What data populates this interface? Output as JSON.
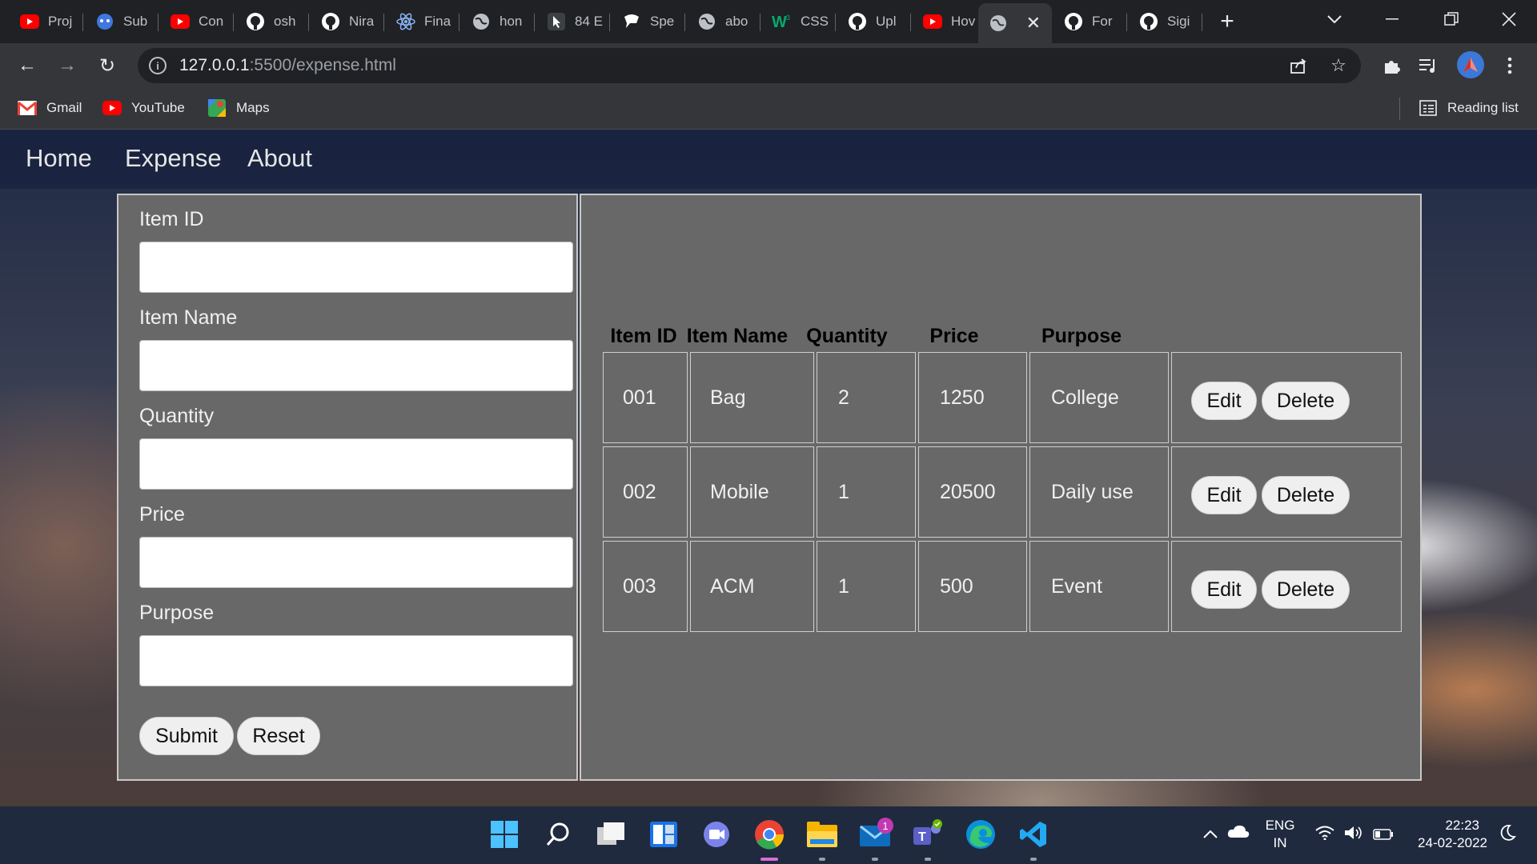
{
  "browser": {
    "tabs": [
      {
        "label": "Proj",
        "icon": "youtube-icon"
      },
      {
        "label": "Sub",
        "icon": "bot-icon"
      },
      {
        "label": "Con",
        "icon": "youtube-icon"
      },
      {
        "label": "osh",
        "icon": "github-icon"
      },
      {
        "label": "Nira",
        "icon": "github-icon"
      },
      {
        "label": "Fina",
        "icon": "react-icon"
      },
      {
        "label": "hon",
        "icon": "globe-icon"
      },
      {
        "label": "84 E",
        "icon": "cursor-icon"
      },
      {
        "label": "Spe",
        "icon": "speech-icon"
      },
      {
        "label": "abo",
        "icon": "globe-icon"
      },
      {
        "label": "CSS",
        "icon": "w3-icon"
      },
      {
        "label": "Upl",
        "icon": "github-icon"
      },
      {
        "label": "Hov",
        "icon": "youtube-icon"
      },
      {
        "label": "",
        "icon": "globe-icon"
      },
      {
        "label": "For",
        "icon": "github-icon"
      },
      {
        "label": "Sigi",
        "icon": "github-icon"
      }
    ],
    "url_host": "127.0.0.1",
    "url_path": ":5500/expense.html",
    "bookmarks": [
      {
        "label": "Gmail",
        "icon": "gmail-icon"
      },
      {
        "label": "YouTube",
        "icon": "youtube-icon"
      },
      {
        "label": "Maps",
        "icon": "maps-icon"
      }
    ],
    "reading_list": "Reading list"
  },
  "nav": {
    "links": [
      "Home",
      "Expense",
      "About"
    ]
  },
  "form": {
    "fields": [
      {
        "label": "Item ID",
        "value": ""
      },
      {
        "label": "Item Name",
        "value": ""
      },
      {
        "label": "Quantity",
        "value": ""
      },
      {
        "label": "Price",
        "value": ""
      },
      {
        "label": "Purpose",
        "value": ""
      }
    ],
    "submit_label": "Submit",
    "reset_label": "Reset"
  },
  "table": {
    "headers": [
      "Item ID",
      "Item Name",
      "Quantity",
      "Price",
      "Purpose"
    ],
    "rows": [
      [
        "001",
        "Bag",
        "2",
        "1250",
        "College"
      ],
      [
        "002",
        "Mobile",
        "1",
        "20500",
        "Daily use"
      ],
      [
        "003",
        "ACM",
        "1",
        "500",
        "Event"
      ]
    ],
    "edit_label": "Edit",
    "delete_label": "Delete"
  },
  "taskbar": {
    "lang_line1": "ENG",
    "lang_line2": "IN",
    "time": "22:23",
    "date": "24-02-2022",
    "mail_badge": "1"
  }
}
